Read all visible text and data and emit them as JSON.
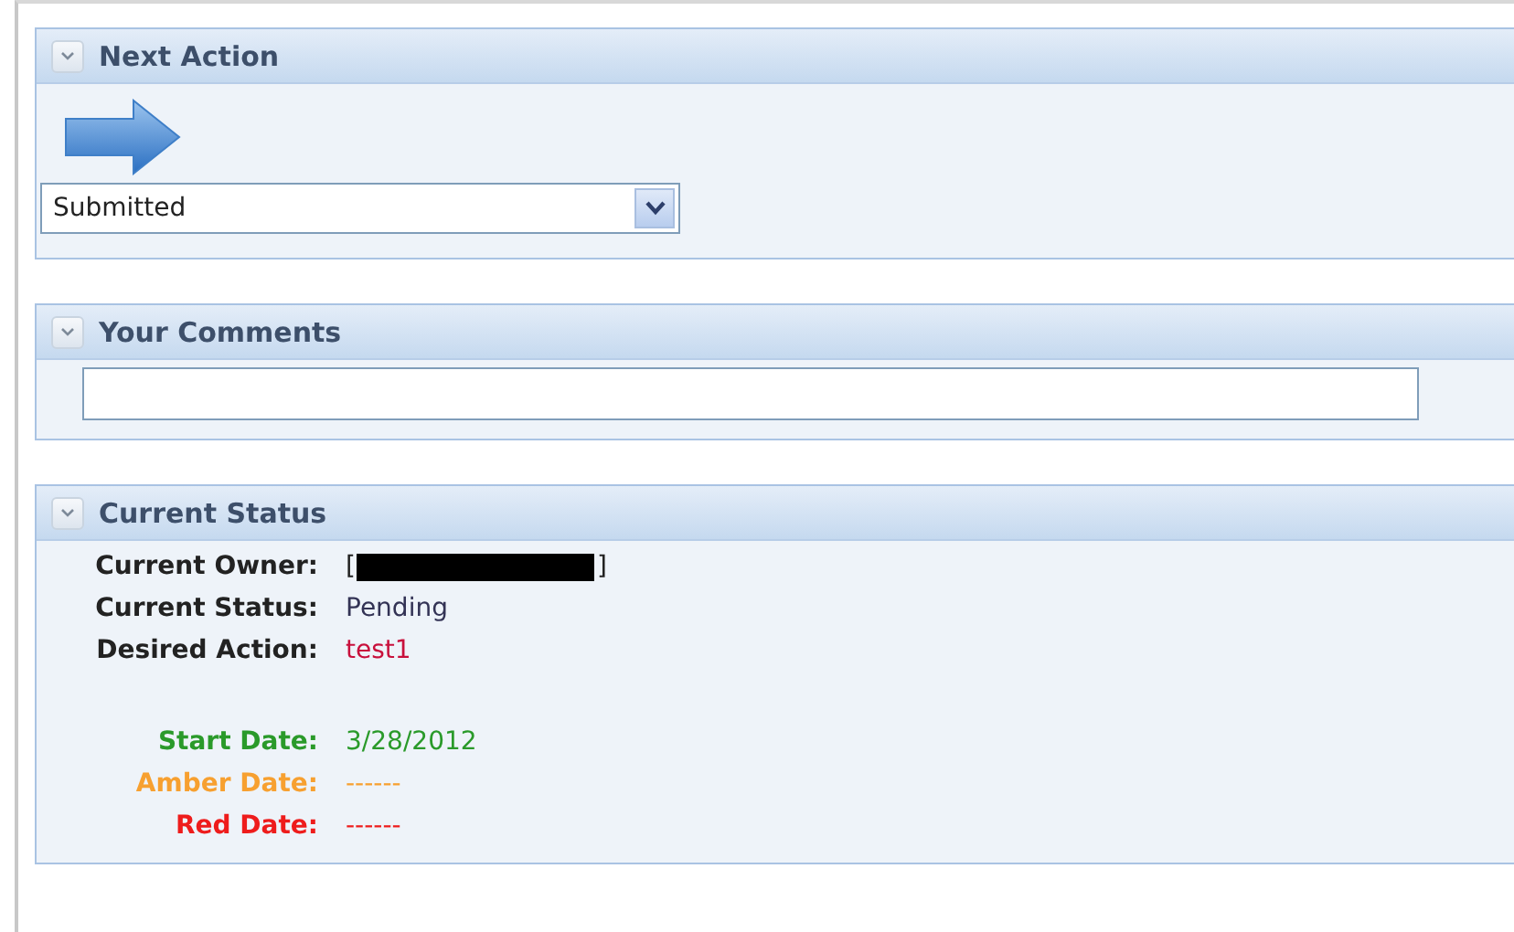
{
  "next_action": {
    "title": "Next Action",
    "expanded": true,
    "select": {
      "value": "Submitted"
    }
  },
  "comments": {
    "title": "Your Comments",
    "expanded": true
  },
  "current_status": {
    "title": "Current Status",
    "expanded": true,
    "details": [
      {
        "label": "Current Owner:",
        "kind": "redacted",
        "open": "[",
        "close": "]"
      },
      {
        "label": "Current Status:",
        "kind": "text",
        "value": "Pending",
        "color": "#333355"
      },
      {
        "label": "Desired Action:",
        "kind": "text",
        "value": "test1",
        "color": "#c8103c"
      }
    ],
    "dates": [
      {
        "label": "Start Date:",
        "value": "3/28/2012",
        "color": "#2a9a2a"
      },
      {
        "label": "Amber Date:",
        "value": "------",
        "color": "#f7a030"
      },
      {
        "label": "Red Date:",
        "value": "------",
        "color": "#ee1c1c"
      }
    ]
  }
}
